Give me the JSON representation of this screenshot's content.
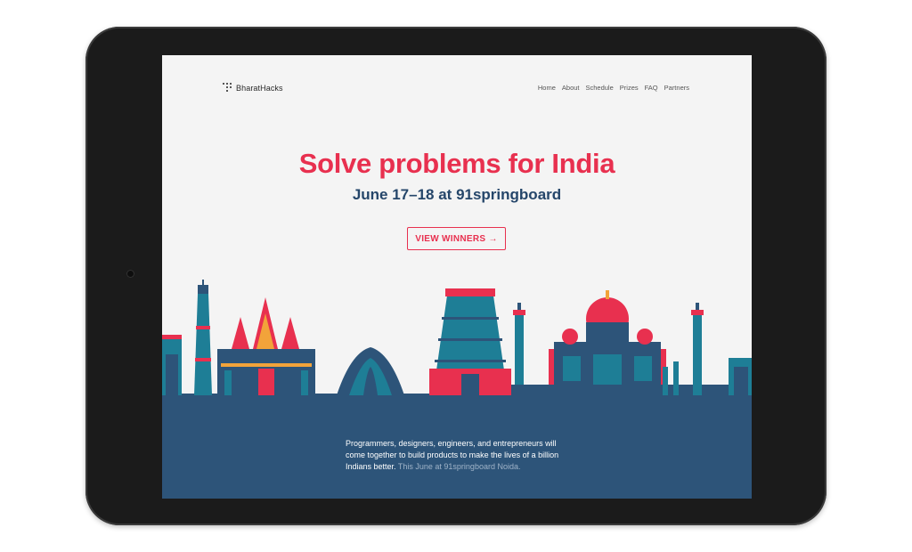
{
  "device": {
    "type": "tablet"
  },
  "header": {
    "brand": "BharatHacks",
    "nav": [
      "Home",
      "About",
      "Schedule",
      "Prizes",
      "FAQ",
      "Partners"
    ]
  },
  "hero": {
    "title": "Solve problems for India",
    "subtitle": "June 17–18 at 91springboard",
    "cta_label": "VIEW WINNERS →"
  },
  "about": {
    "text": "Programmers, designers, engineers, and entrepreneurs will come together to build products to make the lives of a billion Indians better.",
    "text_muted": "This June at 91springboard Noida."
  },
  "colors": {
    "accent": "#e8304f",
    "navy": "#25466a",
    "band": "#2d5479",
    "teal": "#1e7e96",
    "amber": "#f2a33a",
    "background": "#f4f4f4"
  },
  "icons": [
    "logo-mark-icon"
  ]
}
